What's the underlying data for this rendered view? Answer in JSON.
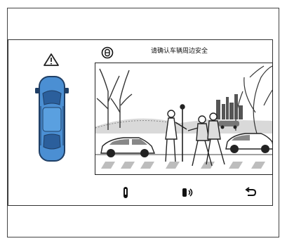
{
  "status": {
    "warning_text": "请确认车辆周边安全"
  },
  "camera": {
    "view_badge_icon": "camera-view-badge-icon"
  },
  "toolbar": {
    "items": [
      {
        "name": "sensor-toggle-button",
        "icon": "parking-sensor-icon"
      },
      {
        "name": "sound-toggle-button",
        "icon": "speaker-icon"
      },
      {
        "name": "back-button",
        "icon": "return-arrow-icon"
      }
    ]
  },
  "vehicle": {
    "warning_icon": "warning-triangle-icon",
    "color": "#4b8fd3"
  }
}
